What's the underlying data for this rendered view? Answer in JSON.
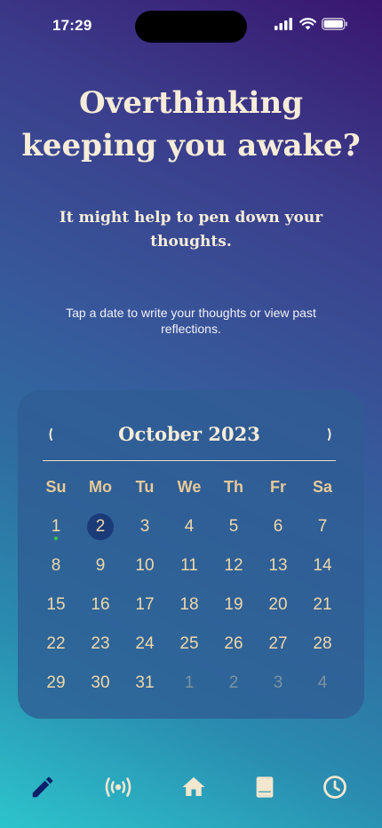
{
  "status_bar": {
    "time": "17:29"
  },
  "headline": {
    "line1": "Overthinking",
    "line2": "keeping you awake?"
  },
  "subheadline": {
    "line1": "It might help to pen down your",
    "line2": "thoughts."
  },
  "instruction": {
    "line1": "Tap a date to write your thoughts or view past",
    "line2": "reflections."
  },
  "calendar": {
    "month_label": "October 2023",
    "prev_icon": "chevron-left-icon",
    "next_icon": "chevron-right-icon",
    "weekdays": [
      "Su",
      "Mo",
      "Tu",
      "We",
      "Th",
      "Fr",
      "Sa"
    ],
    "weeks": [
      [
        "1",
        "2",
        "3",
        "4",
        "5",
        "6",
        "7"
      ],
      [
        "8",
        "9",
        "10",
        "11",
        "12",
        "13",
        "14"
      ],
      [
        "15",
        "16",
        "17",
        "18",
        "19",
        "20",
        "21"
      ],
      [
        "22",
        "23",
        "24",
        "25",
        "26",
        "27",
        "28"
      ],
      [
        "29",
        "30",
        "31",
        "1",
        "2",
        "3",
        "4"
      ]
    ],
    "selected_day": "2",
    "marked_day_with_entry": "1"
  },
  "tab_bar": {
    "items": [
      {
        "icon": "pencil-icon",
        "active": true
      },
      {
        "icon": "broadcast-icon",
        "active": false
      },
      {
        "icon": "home-icon",
        "active": false
      },
      {
        "icon": "book-icon",
        "active": false
      },
      {
        "icon": "clock-icon",
        "active": false
      }
    ]
  },
  "colors": {
    "accent_text": "#f0d7a8",
    "weekday_text": "#e7c998",
    "selected_day_bg": "#1a3a78",
    "entry_dot": "#3bc93b",
    "active_tab": "#0b1f6b",
    "inactive_tab": "#f3e7cf"
  }
}
